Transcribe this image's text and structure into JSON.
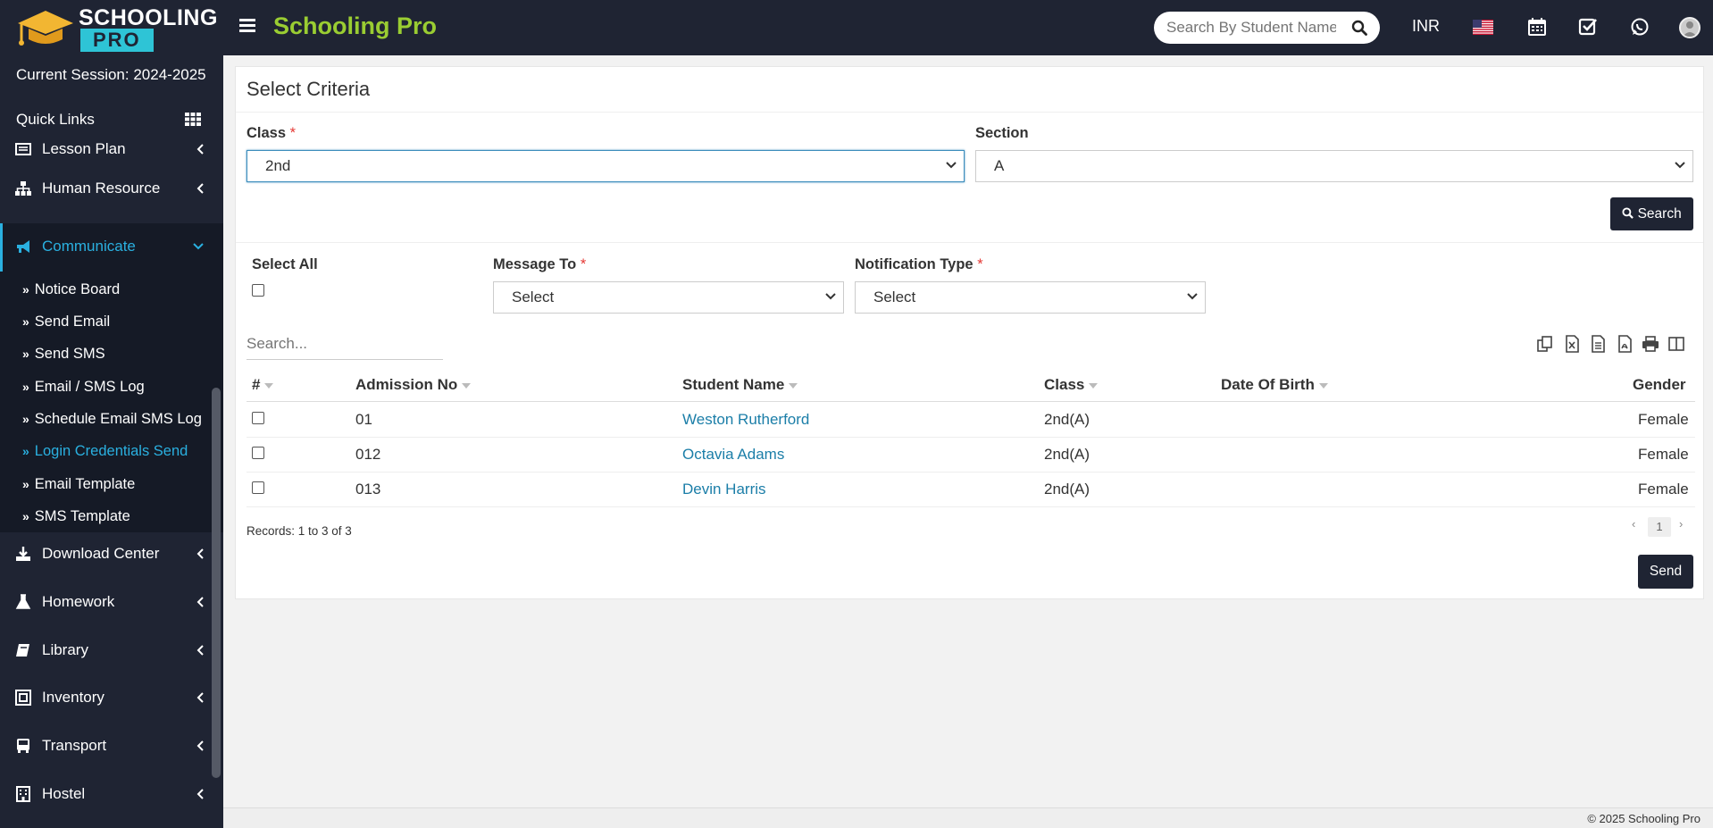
{
  "header": {
    "logo_top": "SCHOOLING",
    "logo_bottom": "PRO",
    "brand": "Schooling Pro",
    "search_placeholder": "Search By Student Name",
    "currency": "INR"
  },
  "sidebar": {
    "session": "Current Session: 2024-2025",
    "quick_links": "Quick Links",
    "items": [
      {
        "label": "Lesson Plan"
      },
      {
        "label": "Human Resource"
      },
      {
        "label": "Communicate"
      },
      {
        "label": "Download Center"
      },
      {
        "label": "Homework"
      },
      {
        "label": "Library"
      },
      {
        "label": "Inventory"
      },
      {
        "label": "Transport"
      },
      {
        "label": "Hostel"
      }
    ],
    "submenu": [
      {
        "label": "Notice Board"
      },
      {
        "label": "Send Email"
      },
      {
        "label": "Send SMS"
      },
      {
        "label": "Email / SMS Log"
      },
      {
        "label": "Schedule Email SMS Log"
      },
      {
        "label": "Login Credentials Send"
      },
      {
        "label": "Email Template"
      },
      {
        "label": "SMS Template"
      }
    ]
  },
  "criteria": {
    "title": "Select Criteria",
    "class_label": "Class",
    "class_value": "2nd",
    "section_label": "Section",
    "section_value": "A",
    "search_button": "Search",
    "select_all": "Select All",
    "message_to_label": "Message To",
    "message_to_value": "Select",
    "notification_label": "Notification Type",
    "notification_value": "Select",
    "required_mark": "*"
  },
  "table": {
    "search_placeholder": "Search...",
    "headers": [
      "#",
      "Admission No",
      "Student Name",
      "Class",
      "Date Of Birth",
      "Gender"
    ],
    "rows": [
      {
        "admission": "01",
        "name": "Weston Rutherford",
        "class": "2nd(A)",
        "dob": "",
        "gender": "Female"
      },
      {
        "admission": "012",
        "name": "Octavia Adams",
        "class": "2nd(A)",
        "dob": "",
        "gender": "Female"
      },
      {
        "admission": "013",
        "name": "Devin Harris",
        "class": "2nd(A)",
        "dob": "",
        "gender": "Female"
      }
    ],
    "records": "Records: 1 to 3 of 3",
    "page": "1",
    "prev": "‹",
    "next": "›",
    "send_button": "Send"
  },
  "footer": {
    "copyright": "© 2025 Schooling Pro"
  },
  "icons": {
    "toolbar": [
      "copy-icon",
      "excel-icon",
      "csv-icon",
      "pdf-icon",
      "print-icon",
      "columns-icon"
    ],
    "topbar": [
      "calendar-icon",
      "task-check-icon",
      "whatsapp-icon",
      "user-avatar"
    ]
  },
  "colors": {
    "sidebar_bg": "#1f2433",
    "brand_green": "#9acd32",
    "active_link": "#2ab0e0",
    "link_blue": "#1b7ea8"
  }
}
